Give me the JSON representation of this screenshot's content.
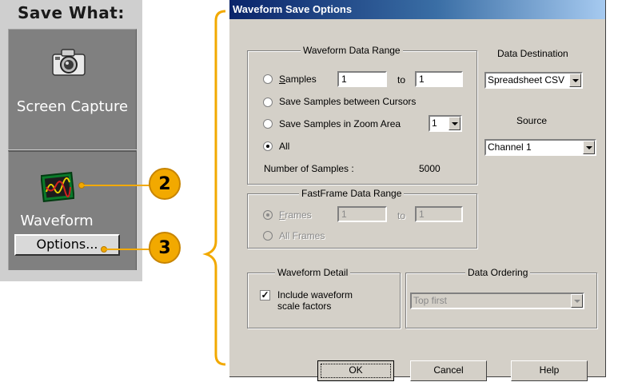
{
  "save_what": {
    "title": "Save What:",
    "screen_capture_label": "Screen Capture",
    "waveform_label": "Waveform",
    "options_button": "Options..."
  },
  "callouts": [
    "2",
    "3"
  ],
  "dialog": {
    "title": "Waveform Save Options",
    "data_range": {
      "title": "Waveform Data Range",
      "samples_label": "Samples",
      "samples_from": "1",
      "to_label": "to",
      "samples_to": "1",
      "between_cursors_label": "Save Samples between Cursors",
      "zoom_area_label": "Save Samples in Zoom Area",
      "zoom_value": "1",
      "all_label": "All",
      "num_samples_label": "Number of Samples :",
      "num_samples_value": "5000"
    },
    "data_destination": {
      "label": "Data Destination",
      "value": "Spreadsheet CSV"
    },
    "source": {
      "label": "Source",
      "value": "Channel 1"
    },
    "fastframe": {
      "title": "FastFrame Data Range",
      "frames_label": "Frames",
      "frames_from": "1",
      "to_label": "to",
      "frames_to": "1",
      "all_frames_label": "All Frames"
    },
    "waveform_detail": {
      "title": "Waveform Detail",
      "include_label_1": "Include waveform",
      "include_label_2": "scale factors",
      "checked": true
    },
    "data_ordering": {
      "title": "Data Ordering",
      "value": "Top first"
    },
    "buttons": {
      "ok": "OK",
      "cancel": "Cancel",
      "help": "Help"
    }
  },
  "colors": {
    "callout": "#f2a900",
    "titlebar": "#0a246a",
    "dialog_bg": "#d4d0c8",
    "panel_bg": "#808080"
  }
}
